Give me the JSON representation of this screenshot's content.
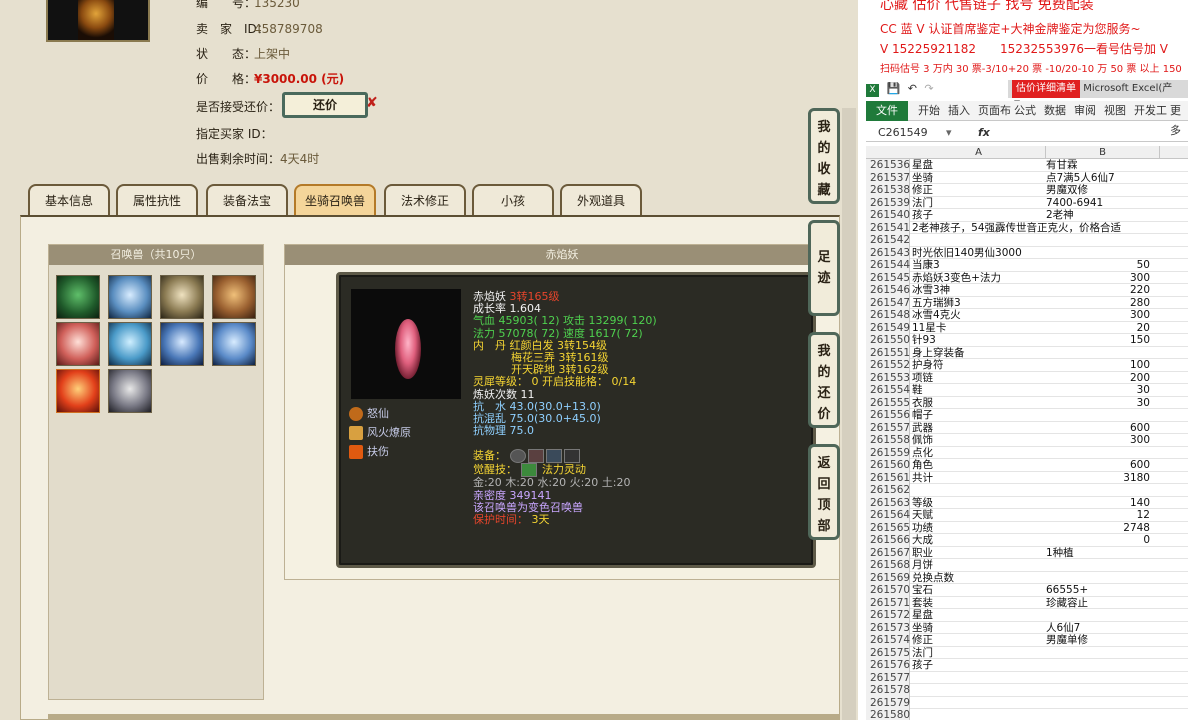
{
  "seller_info": {
    "row0_label": "编　　号：",
    "row0_value": "135230",
    "seller_label": "卖　家　ID：",
    "seller_value": "458789708",
    "status_label": "状　　态：",
    "status_value": "上架中",
    "price_label": "价　　格：",
    "price_value": "¥3000.00 (元)",
    "counter_label": "是否接受还价：",
    "counter_button": "还价",
    "buyer_label": "指定买家 ID：",
    "time_label": "出售剩余时间：",
    "time_value": "4天4时"
  },
  "tabs": [
    "基本信息",
    "属性抗性",
    "装备法宝",
    "坐骑召唤兽",
    "法术修正",
    "小孩",
    "外观道具"
  ],
  "active_tab": "坐骑召唤兽",
  "pet_list": {
    "header": "召唤兽（共10只）"
  },
  "pet_detail": {
    "header": "赤焰妖",
    "name": "赤焰妖",
    "level": "3转165级",
    "growth": "成长率 1.604",
    "hp": "气血 45903( 12) 攻击 13299( 120)",
    "mp": "法力 57078( 72) 速度 1617( 72)",
    "neidan_1": "内　丹 红颜白发 3转154级",
    "neidan_2": "梅花三弄 3转161级",
    "neidan_3": "开天辟地 3转162级",
    "lingxi": "灵犀等级： 0 开启技能格： 0/14",
    "lianyao": "炼妖次数 11",
    "kang_shui": "抗　水 43.0(30.0+13.0)",
    "kang_hunluan": "抗混乱 75.0(30.0+45.0)",
    "kang_wuli": "抗物理 75.0",
    "equip_label": "装备：",
    "juexing_label": "觉醒技：",
    "juexing_value": "法力灵动",
    "elements": "金:20 木:20 水:20 火:20 土:20",
    "qinmi": "亲密度 349141",
    "note": "该召唤兽为变色召唤兽",
    "protect_label": "保护时间：",
    "protect_value": "3天",
    "skills": [
      "怒仙",
      "风火燎原",
      "扶伤"
    ]
  },
  "side_buttons": [
    "我的收藏",
    "足迹",
    "我的还价",
    "返回顶部"
  ],
  "ads": {
    "line0": "心藏 估价 代售链子 找号 免费配装",
    "line1": "CC 蓝 V 认证首席鉴定+大神金牌鉴定为您服务~",
    "line2": "V 15225921182　　15232553976一看号估号加 V",
    "line3": "扫码估号 3 万内 30 票-3/10+20 票 -10/20-10 万 50 票 以上 150"
  },
  "excel": {
    "window_title": "Microsoft Excel(产品...",
    "title_red": "估价详细清单",
    "ribbon_tabs": [
      "文件",
      "开始",
      "插入",
      "页面布",
      "公式",
      "数据",
      "审阅",
      "视图",
      "开发工",
      "更多"
    ],
    "name_box": "C261549",
    "fx": "fx",
    "col_a": "A",
    "col_b": "B",
    "rows": [
      {
        "n": "261536",
        "a": "星盘",
        "b": "有甘霖"
      },
      {
        "n": "261537",
        "a": "坐骑",
        "b": "点7满5人6仙7"
      },
      {
        "n": "261538",
        "a": "修正",
        "b": "男魔双修"
      },
      {
        "n": "261539",
        "a": "法门",
        "b": "7400-6941"
      },
      {
        "n": "261540",
        "a": "孩子",
        "b": "2老神"
      },
      {
        "n": "261541",
        "a": "2老神孩子，54强霹传世音正克火，价格合适",
        "b": ""
      },
      {
        "n": "261542",
        "a": "",
        "b": ""
      },
      {
        "n": "261543",
        "a": "时光依旧140男仙3000",
        "b": ""
      },
      {
        "n": "261544",
        "a": "当康3",
        "b": "50"
      },
      {
        "n": "261545",
        "a": "赤焰妖3变色+法力",
        "b": "300"
      },
      {
        "n": "261546",
        "a": "冰雪3神",
        "b": "220"
      },
      {
        "n": "261547",
        "a": "五方瑞狮3",
        "b": "280"
      },
      {
        "n": "261548",
        "a": "冰雪4克火",
        "b": "300"
      },
      {
        "n": "261549",
        "a": "11星卡",
        "b": "20"
      },
      {
        "n": "261550",
        "a": "针93",
        "b": "150"
      },
      {
        "n": "261551",
        "a": "身上穿装备",
        "b": ""
      },
      {
        "n": "261552",
        "a": "护身符",
        "b": "100"
      },
      {
        "n": "261553",
        "a": "项链",
        "b": "200"
      },
      {
        "n": "261554",
        "a": "鞋",
        "b": "30"
      },
      {
        "n": "261555",
        "a": "衣服",
        "b": "30"
      },
      {
        "n": "261556",
        "a": "帽子",
        "b": ""
      },
      {
        "n": "261557",
        "a": "武器",
        "b": "600"
      },
      {
        "n": "261558",
        "a": "佩饰",
        "b": "300"
      },
      {
        "n": "261559",
        "a": "点化",
        "b": ""
      },
      {
        "n": "261560",
        "a": "角色",
        "b": "600"
      },
      {
        "n": "261561",
        "a": "共计",
        "b": "3180"
      },
      {
        "n": "261562",
        "a": "",
        "b": ""
      },
      {
        "n": "261563",
        "a": "等级",
        "b": "140"
      },
      {
        "n": "261564",
        "a": "天赋",
        "b": "12"
      },
      {
        "n": "261565",
        "a": "功绩",
        "b": "2748"
      },
      {
        "n": "261566",
        "a": "大成",
        "b": "0"
      },
      {
        "n": "261567",
        "a": "职业",
        "b": "1种植"
      },
      {
        "n": "261568",
        "a": "月饼",
        "b": ""
      },
      {
        "n": "261569",
        "a": "兑换点数",
        "b": ""
      },
      {
        "n": "261570",
        "a": "宝石",
        "b": "66555+"
      },
      {
        "n": "261571",
        "a": "套装",
        "b": "珍藏容止"
      },
      {
        "n": "261572",
        "a": "星盘",
        "b": ""
      },
      {
        "n": "261573",
        "a": "坐骑",
        "b": "人6仙7"
      },
      {
        "n": "261574",
        "a": "修正",
        "b": "男魔单修"
      },
      {
        "n": "261575",
        "a": "法门",
        "b": ""
      },
      {
        "n": "261576",
        "a": "孩子",
        "b": ""
      },
      {
        "n": "261577",
        "a": "",
        "b": ""
      },
      {
        "n": "261578",
        "a": "",
        "b": ""
      },
      {
        "n": "261579",
        "a": "",
        "b": ""
      },
      {
        "n": "261580",
        "a": "",
        "b": ""
      }
    ]
  }
}
